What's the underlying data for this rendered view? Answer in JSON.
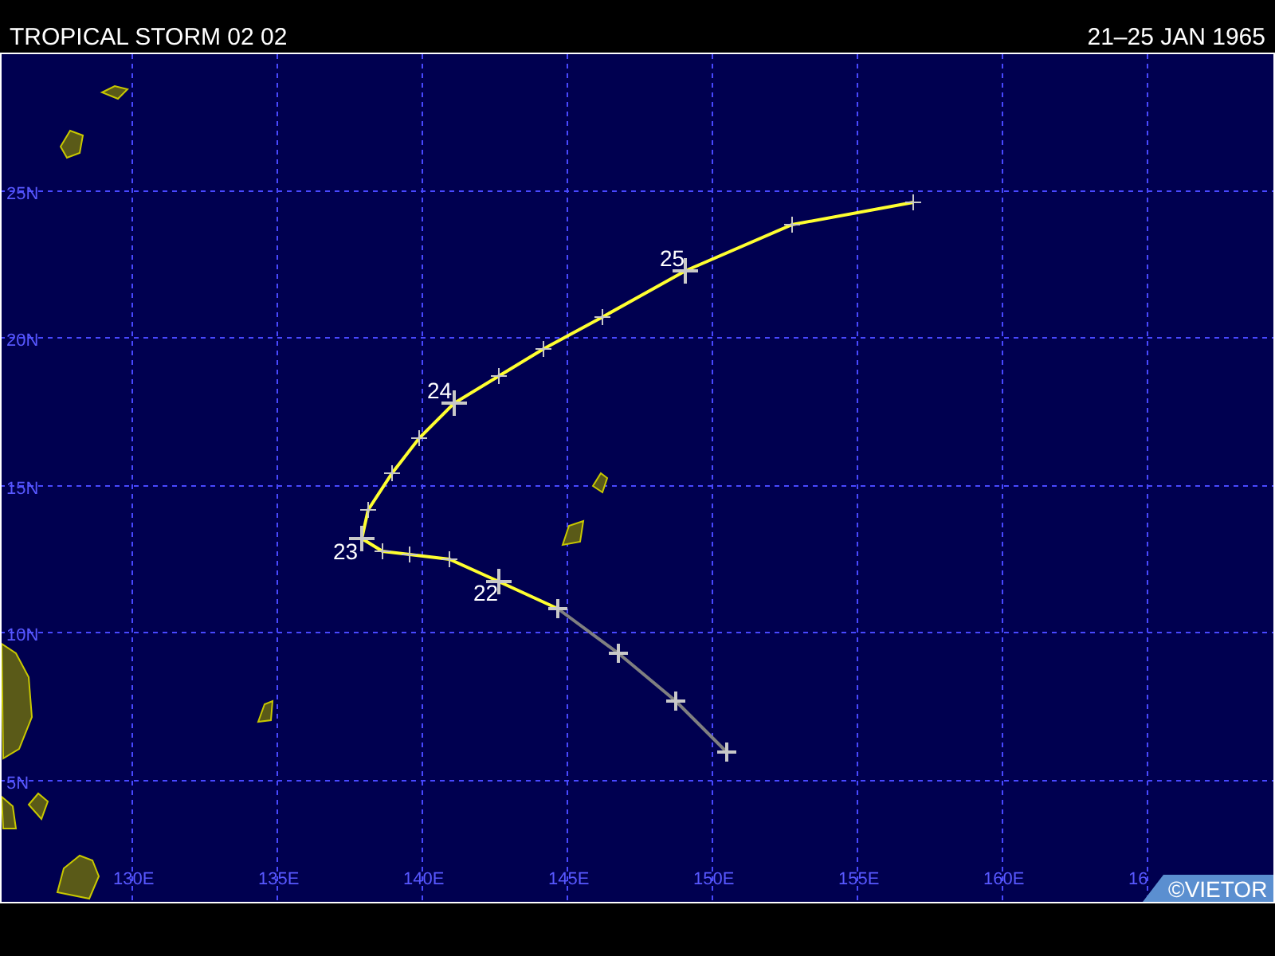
{
  "header": {
    "title": "TROPICAL STORM 02 02",
    "dates": "21–25 JAN 1965"
  },
  "map": {
    "latitude_labels": [
      "25N",
      "20N",
      "15N",
      "10N",
      "5N"
    ],
    "longitude_labels": [
      "130E",
      "135E",
      "140E",
      "145E",
      "150E",
      "155E",
      "160E",
      "16"
    ],
    "day_labels": [
      "22",
      "23",
      "24",
      "25"
    ],
    "credit": "©VIETOR"
  }
}
